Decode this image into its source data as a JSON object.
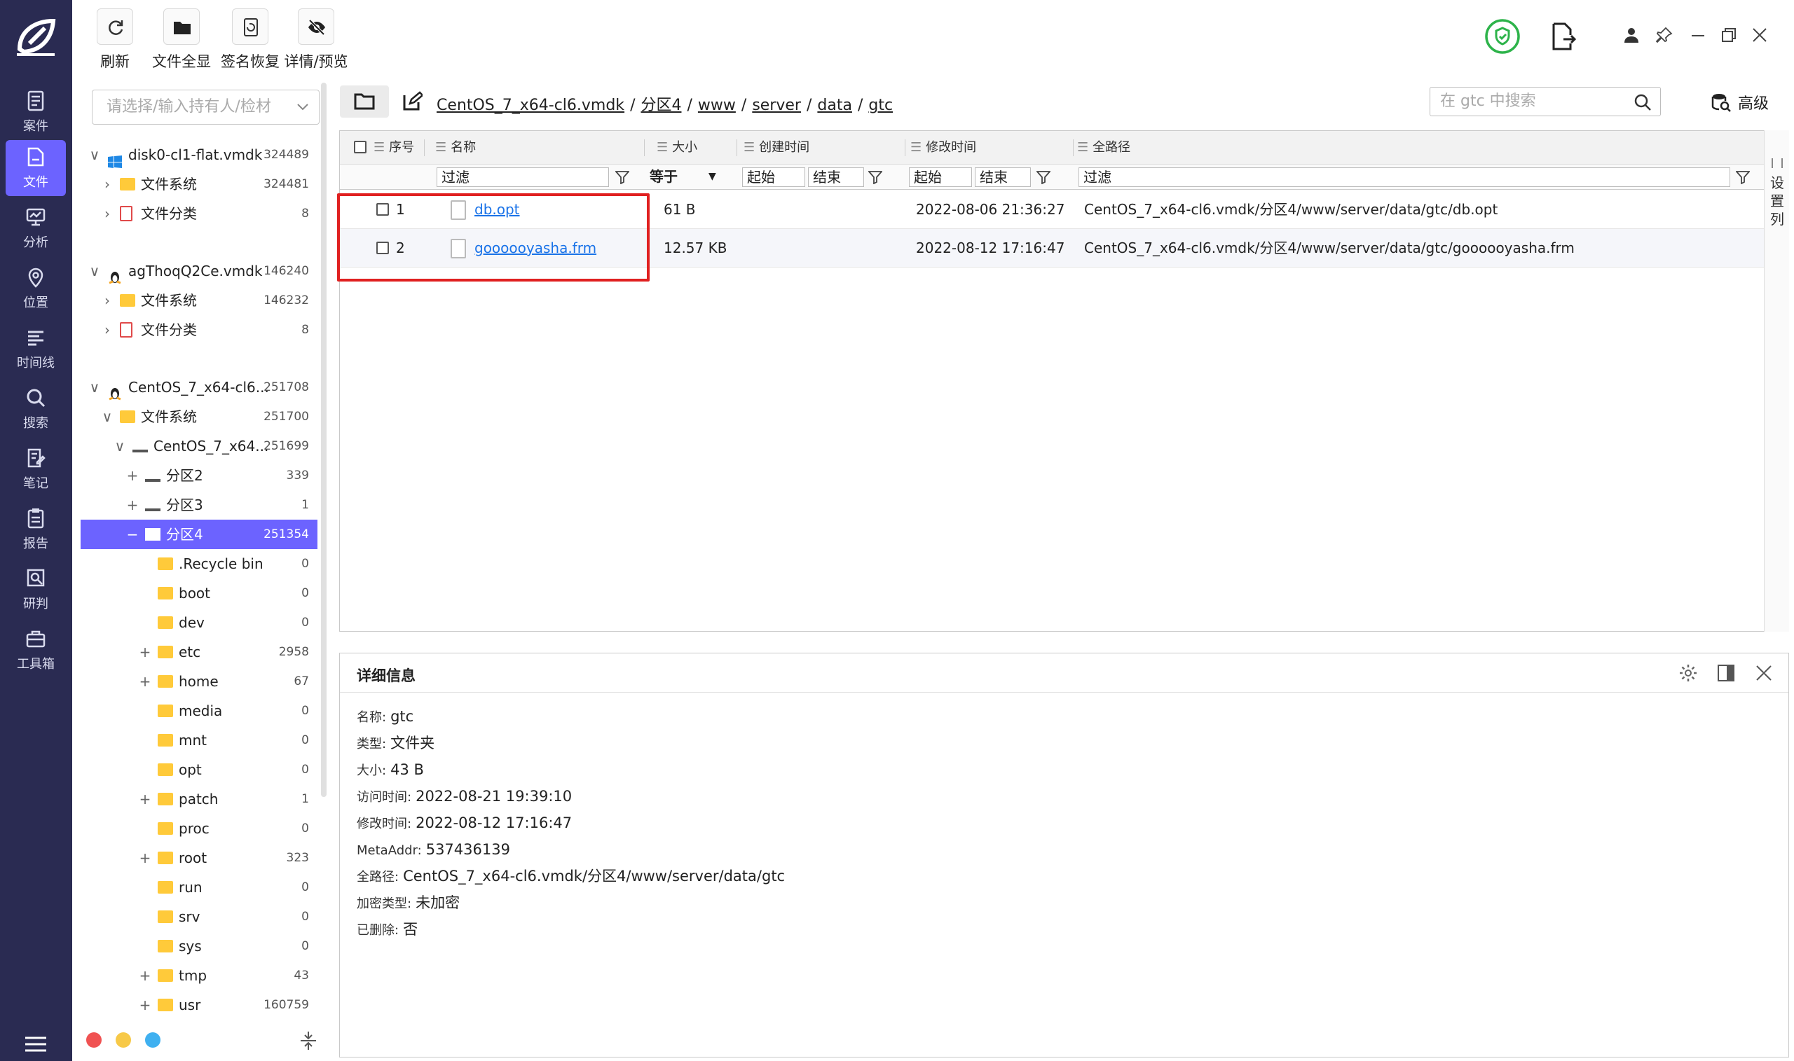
{
  "toolbar": {
    "buttons": [
      {
        "label": "刷新",
        "icon": "refresh-icon"
      },
      {
        "label": "文件全显",
        "icon": "folder-icon"
      },
      {
        "label": "签名恢复",
        "icon": "signature-icon"
      },
      {
        "label": "详情/预览",
        "icon": "eye-off-icon"
      }
    ]
  },
  "rail": {
    "items": [
      {
        "label": "案件",
        "icon": "case-icon"
      },
      {
        "label": "文件",
        "icon": "file-icon",
        "active": true
      },
      {
        "label": "分析",
        "icon": "analysis-icon"
      },
      {
        "label": "位置",
        "icon": "location-icon"
      },
      {
        "label": "时间线",
        "icon": "timeline-icon"
      },
      {
        "label": "搜索",
        "icon": "search-icon"
      },
      {
        "label": "笔记",
        "icon": "notes-icon"
      },
      {
        "label": "报告",
        "icon": "report-icon"
      },
      {
        "label": "研判",
        "icon": "analysis-judge-icon"
      },
      {
        "label": "工具箱",
        "icon": "toolbox-icon"
      }
    ]
  },
  "tree": {
    "search_placeholder": "请选择/输入持有人/检材",
    "rows": [
      {
        "toggle": "∨",
        "icon": "windows",
        "name": "disk0-cl1-flat.vmdk",
        "count": "324489"
      },
      {
        "toggle": "›",
        "icon": "folder",
        "name": "文件系统",
        "count": "324481"
      },
      {
        "toggle": "›",
        "icon": "category",
        "name": "文件分类",
        "count": "8"
      },
      {
        "toggle": "∨",
        "icon": "linux",
        "name": "agThoqQ2Ce.vmdk",
        "count": "146240"
      },
      {
        "toggle": "›",
        "icon": "folder",
        "name": "文件系统",
        "count": "146232"
      },
      {
        "toggle": "›",
        "icon": "category",
        "name": "文件分类",
        "count": "8"
      },
      {
        "toggle": "∨",
        "icon": "linux",
        "name": "CentOS_7_x64-cl6...",
        "count": "251708"
      },
      {
        "toggle": "∨",
        "icon": "folder",
        "name": "文件系统",
        "count": "251700"
      },
      {
        "toggle": "∨",
        "icon": "drive",
        "name": "CentOS_7_x64...",
        "count": "251699"
      },
      {
        "toggle": "+",
        "icon": "drive",
        "name": "分区2",
        "count": "339"
      },
      {
        "toggle": "+",
        "icon": "drive",
        "name": "分区3",
        "count": "1"
      },
      {
        "toggle": "−",
        "icon": "drive",
        "name": "分区4",
        "count": "251354",
        "selected": true
      },
      {
        "toggle": "",
        "icon": "folder",
        "name": ".Recycle bin",
        "count": "0"
      },
      {
        "toggle": "",
        "icon": "folder",
        "name": "boot",
        "count": "0"
      },
      {
        "toggle": "",
        "icon": "folder",
        "name": "dev",
        "count": "0"
      },
      {
        "toggle": "+",
        "icon": "folder",
        "name": "etc",
        "count": "2958"
      },
      {
        "toggle": "+",
        "icon": "folder",
        "name": "home",
        "count": "67"
      },
      {
        "toggle": "",
        "icon": "folder",
        "name": "media",
        "count": "0"
      },
      {
        "toggle": "",
        "icon": "folder",
        "name": "mnt",
        "count": "0"
      },
      {
        "toggle": "",
        "icon": "folder",
        "name": "opt",
        "count": "0"
      },
      {
        "toggle": "+",
        "icon": "folder",
        "name": "patch",
        "count": "1"
      },
      {
        "toggle": "",
        "icon": "folder",
        "name": "proc",
        "count": "0"
      },
      {
        "toggle": "+",
        "icon": "folder",
        "name": "root",
        "count": "323"
      },
      {
        "toggle": "",
        "icon": "folder",
        "name": "run",
        "count": "0"
      },
      {
        "toggle": "",
        "icon": "folder",
        "name": "srv",
        "count": "0"
      },
      {
        "toggle": "",
        "icon": "folder",
        "name": "sys",
        "count": "0"
      },
      {
        "toggle": "+",
        "icon": "folder",
        "name": "tmp",
        "count": "43"
      },
      {
        "toggle": "+",
        "icon": "folder",
        "name": "usr",
        "count": "160759"
      }
    ]
  },
  "path": {
    "crumbs": [
      "CentOS_7_x64-cl6.vmdk",
      "分区4",
      "www",
      "server",
      "data",
      "gtc"
    ],
    "search_placeholder": "在 gtc 中搜索",
    "advanced_label": "高级"
  },
  "table": {
    "headers": {
      "index": "序号",
      "name": "名称",
      "size": "大小",
      "created": "创建时间",
      "modified": "修改时间",
      "fullpath": "全路径"
    },
    "filters": {
      "name": "过滤",
      "size_op": "等于",
      "created_start": "起始",
      "created_end": "结束",
      "modified_start": "起始",
      "modified_end": "结束",
      "fullpath": "过滤"
    },
    "rows": [
      {
        "index": "1",
        "name": "db.opt",
        "size": "61 B",
        "created": "",
        "modified": "2022-08-06 21:36:27",
        "fullpath": "CentOS_7_x64-cl6.vmdk/分区4/www/server/data/gtc/db.opt"
      },
      {
        "index": "2",
        "name": "goooooyasha.frm",
        "size": "12.57 KB",
        "created": "",
        "modified": "2022-08-12 17:16:47",
        "fullpath": "CentOS_7_x64-cl6.vmdk/分区4/www/server/data/gtc/goooooyasha.frm"
      }
    ],
    "side_settings_label": "设置列"
  },
  "detail": {
    "title": "详细信息",
    "fields": [
      {
        "key": "名称:",
        "value": "gtc"
      },
      {
        "key": "类型:",
        "value": "文件夹"
      },
      {
        "key": "大小:",
        "value": "43 B"
      },
      {
        "key": "访问时间:",
        "value": "2022-08-21 19:39:10"
      },
      {
        "key": "修改时间:",
        "value": "2022-08-12 17:16:47"
      },
      {
        "key": "MetaAddr:",
        "value": "537436139"
      },
      {
        "key": "全路径:",
        "value": "CentOS_7_x64-cl6.vmdk/分区4/www/server/data/gtc"
      },
      {
        "key": "加密类型:",
        "value": "未加密"
      },
      {
        "key": "已删除:",
        "value": "否"
      }
    ]
  },
  "colors": {
    "rail_bg": "#2a2b52",
    "accent": "#6c63ff",
    "highlight_box": "#e02020",
    "link": "#1a73e8",
    "folder": "#ffca3a"
  }
}
